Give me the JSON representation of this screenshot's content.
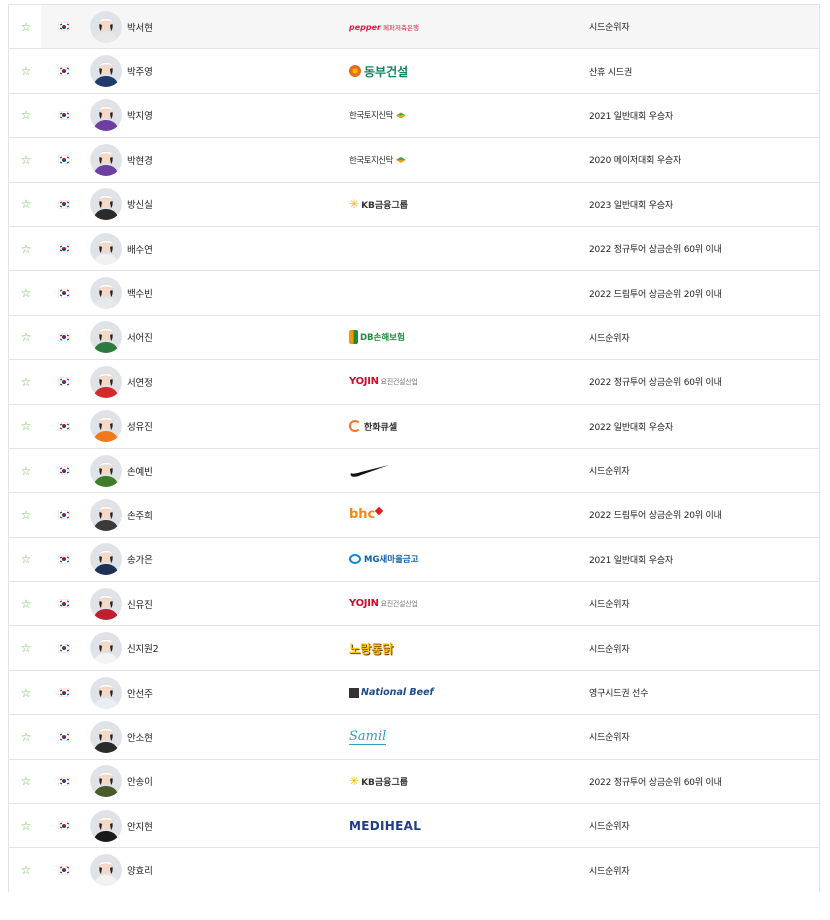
{
  "players": [
    {
      "name": "박서현",
      "sponsor": "pepper 페퍼저축은행",
      "sponsor_logo": "pepper",
      "qualification": "시드순위자",
      "avatar_shirt": "#e8e8e8"
    },
    {
      "name": "박주영",
      "sponsor": "동부건설",
      "sponsor_logo": "dongbu",
      "qualification": "산휴 시드권",
      "avatar_shirt": "#1f3a6b"
    },
    {
      "name": "박지영",
      "sponsor": "한국토지신탁",
      "sponsor_logo": "koreit",
      "qualification": "2021 일반대회 우승자",
      "avatar_shirt": "#6d3fa0"
    },
    {
      "name": "박현경",
      "sponsor": "한국토지신탁",
      "sponsor_logo": "koreit",
      "qualification": "2020 메이저대회 우승자",
      "avatar_shirt": "#6d3fa0"
    },
    {
      "name": "방신실",
      "sponsor": "KB금융그룹",
      "sponsor_logo": "kb",
      "qualification": "2023 일반대회 우승자",
      "avatar_shirt": "#2b2b2b"
    },
    {
      "name": "배수연",
      "sponsor": "",
      "sponsor_logo": "",
      "qualification": "2022 정규투어 상금순위 60위 이내",
      "avatar_shirt": "#f1f1f1"
    },
    {
      "name": "백수빈",
      "sponsor": "",
      "sponsor_logo": "",
      "qualification": "2022 드림투어 상금순위 20위 이내",
      "avatar_shirt": "#e8e8e8"
    },
    {
      "name": "서어진",
      "sponsor": "DB손해보험",
      "sponsor_logo": "db",
      "qualification": "시드순위자",
      "avatar_shirt": "#2c7a3f"
    },
    {
      "name": "서연정",
      "sponsor": "YOJIN 요진건설산업",
      "sponsor_logo": "yojin",
      "qualification": "2022 정규투어 상금순위 60위 이내",
      "avatar_shirt": "#d42a2a"
    },
    {
      "name": "성유진",
      "sponsor": "한화큐셀",
      "sponsor_logo": "hanwha",
      "qualification": "2022 일반대회 우승자",
      "avatar_shirt": "#f07a1a"
    },
    {
      "name": "손예빈",
      "sponsor": "Nike",
      "sponsor_logo": "nike",
      "qualification": "시드순위자",
      "avatar_shirt": "#3f7d2a"
    },
    {
      "name": "손주희",
      "sponsor": "bhc",
      "sponsor_logo": "bhc",
      "qualification": "2022 드림투어 상금순위 20위 이내",
      "avatar_shirt": "#3a3a3a"
    },
    {
      "name": "송가은",
      "sponsor": "MG새마을금고",
      "sponsor_logo": "mg",
      "qualification": "2021 일반대회 우승자",
      "avatar_shirt": "#1f2f55"
    },
    {
      "name": "신유진",
      "sponsor": "YOJIN 요진건설산업",
      "sponsor_logo": "yojin",
      "qualification": "시드순위자",
      "avatar_shirt": "#c01f2f"
    },
    {
      "name": "신지원2",
      "sponsor": "노랑통닭",
      "sponsor_logo": "norang",
      "qualification": "시드순위자",
      "avatar_shirt": "#f4f4f4"
    },
    {
      "name": "안선주",
      "sponsor": "National Beef",
      "sponsor_logo": "nbeef",
      "qualification": "영구시드권 선수",
      "avatar_shirt": "#e9eef4"
    },
    {
      "name": "안소현",
      "sponsor": "Samil",
      "sponsor_logo": "samil",
      "qualification": "시드순위자",
      "avatar_shirt": "#2a2a2a"
    },
    {
      "name": "안송이",
      "sponsor": "KB금융그룹",
      "sponsor_logo": "kb",
      "qualification": "2022 정규투어 상금순위 60위 이내",
      "avatar_shirt": "#4a5a2a"
    },
    {
      "name": "안지현",
      "sponsor": "MEDIHEAL",
      "sponsor_logo": "mediheal",
      "qualification": "시드순위자",
      "avatar_shirt": "#1a1a1a"
    },
    {
      "name": "양효리",
      "sponsor": "",
      "sponsor_logo": "",
      "qualification": "시드순위자",
      "avatar_shirt": "#f2f2f2"
    }
  ],
  "colors": {
    "star": "#66b84a",
    "border": "#e3e3e3",
    "highlight_row": "#f6f6f6"
  },
  "icons": {
    "favorite": "star-outline-icon",
    "country": "korea-flag-icon"
  }
}
